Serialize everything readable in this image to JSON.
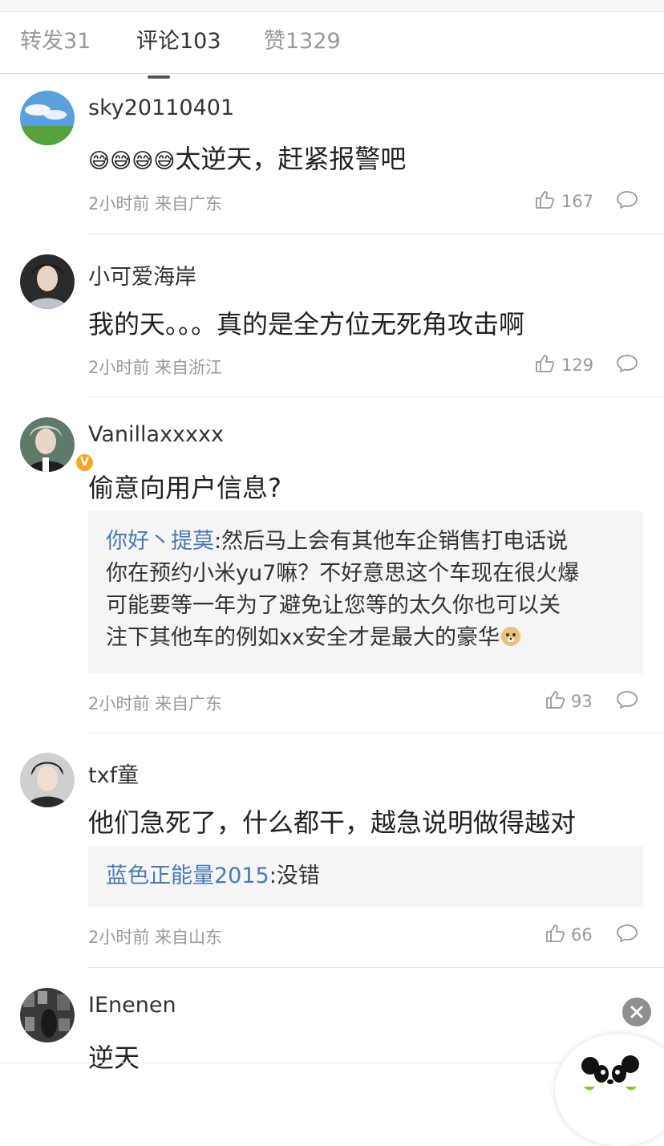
{
  "tabs": [
    {
      "label": "转发31",
      "active": false
    },
    {
      "label": "评论103",
      "active": true
    },
    {
      "label": "赞1329",
      "active": false
    }
  ],
  "comments": [
    {
      "username": "sky20110401",
      "emoji_prefix": "😅😅😅😅",
      "content": "太逆天，赶紧报警吧",
      "meta": "2小时前 来自广东",
      "likes": "167"
    },
    {
      "username": "小可爱海岸",
      "content": "我的天。。。真的是全方位无死角攻击啊",
      "meta": "2小时前 来自浙江",
      "likes": "129"
    },
    {
      "username": "Vanillaxxxxx",
      "content": "偷意向用户信息?",
      "badge": "V",
      "reply": {
        "name": "你好丶提莫",
        "lines": [
          ":然后马上会有其他车企销售打电话说",
          "你在预约小米yu7嘛？不好意思这个车现在很火爆",
          "可能要等一年为了避免让您等的太久你也可以关",
          "注下其他车的例如xx安全才是最大的豪华"
        ]
      },
      "meta": "2小时前 来自广东",
      "likes": "93"
    },
    {
      "username": "txf童",
      "content": "他们急死了，什么都干，越急说明做得越对",
      "reply": {
        "name": "蓝色正能量2015",
        "text": ":没错"
      },
      "meta": "2小时前 来自山东",
      "likes": "66"
    },
    {
      "username": "IEnenen",
      "content": "逆天"
    }
  ],
  "colors": {
    "link": "#4a79b4",
    "meta": "#9a9a9a",
    "reply_bg": "#f5f5f5",
    "badge": "#f5a623"
  },
  "close_symbol": "✕"
}
